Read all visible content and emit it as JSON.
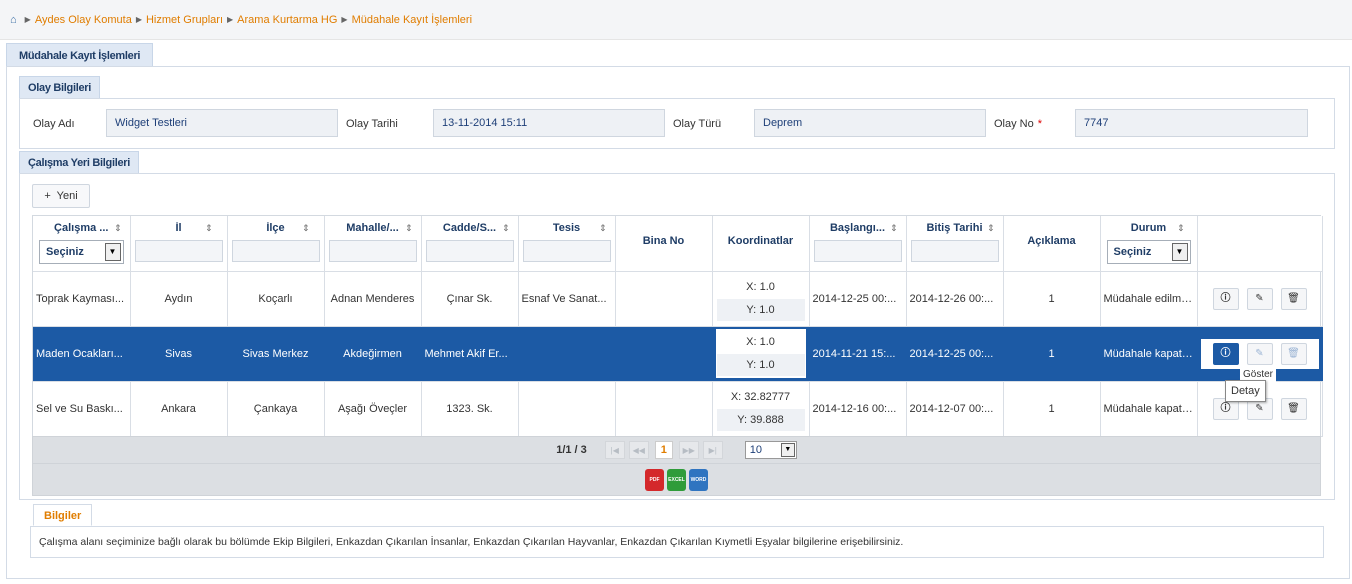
{
  "breadcrumb": {
    "items": [
      "Aydes Olay Komuta",
      "Hizmet Grupları",
      "Arama Kurtarma HG",
      "Müdahale Kayıt İşlemleri"
    ]
  },
  "page_tab": "Müdahale Kayıt İşlemleri",
  "olay": {
    "title": "Olay Bilgileri",
    "fields": [
      {
        "label": "Olay Adı",
        "value": "Widget Testleri"
      },
      {
        "label": "Olay Tarihi",
        "value": "13-11-2014 15:11"
      },
      {
        "label": "Olay Türü",
        "value": "Deprem"
      },
      {
        "label": "Olay No",
        "value": "7747",
        "required": "*"
      }
    ]
  },
  "calisma": {
    "title": "Çalışma Yeri Bilgileri",
    "new_button": "Yeni",
    "columns": [
      "Çalışma ...",
      "İl",
      "İlçe",
      "Mahalle/...",
      "Cadde/S...",
      "Tesis",
      "Bina No",
      "Koordinatlar",
      "Başlangı...",
      "Bitiş Tarihi",
      "Açıklama",
      "Durum"
    ],
    "select_placeholder": "Seçiniz",
    "rows": [
      {
        "calisma": "Toprak Kayması...",
        "il": "Aydın",
        "ilce": "Koçarlı",
        "mahalle": "Adnan Menderes",
        "cadde": "Çınar Sk.",
        "tesis": "Esnaf Ve Sanat...",
        "bina": "",
        "x": "X: 1.0",
        "y": "Y: 1.0",
        "baslangic": "2014-12-25 00:...",
        "bitis": "2014-12-26 00:...",
        "aciklama": "1",
        "durum": "Müdahale edilmedi"
      },
      {
        "calisma": "Maden Ocakları...",
        "il": "Sivas",
        "ilce": "Sivas Merkez",
        "mahalle": "Akdeğirmen",
        "cadde": "Mehmet Akif Er...",
        "tesis": "",
        "bina": "",
        "x": "X: 1.0",
        "y": "Y: 1.0",
        "baslangic": "2014-11-21 15:...",
        "bitis": "2014-12-25 00:...",
        "aciklama": "1",
        "durum": "Müdahale kapatıldı"
      },
      {
        "calisma": "Sel ve Su Baskı...",
        "il": "Ankara",
        "ilce": "Çankaya",
        "mahalle": "Aşağı Öveçler",
        "cadde": "1323. Sk.",
        "tesis": "",
        "bina": "",
        "x": "X: 32.82777",
        "y": "Y: 39.888",
        "baslangic": "2014-12-16 00:...",
        "bitis": "2014-12-07 00:...",
        "aciklama": "1",
        "durum": "Müdahale kapatıldı"
      }
    ]
  },
  "pager": {
    "info": "1/1 / 3",
    "current": "1",
    "page_size": "10"
  },
  "export": [
    "PDF",
    "EXCEL",
    "WORD"
  ],
  "tooltip": {
    "small": "Göster",
    "main": "Detay"
  },
  "bilgiler": {
    "tab": "Bilgiler",
    "text": "Çalışma alanı seçiminize bağlı olarak bu bölümde Ekip Bilgileri, Enkazdan Çıkarılan İnsanlar, Enkazdan Çıkarılan Hayvanlar, Enkazdan Çıkarılan Kıymetli Eşyalar bilgilerine erişebilirsiniz."
  }
}
